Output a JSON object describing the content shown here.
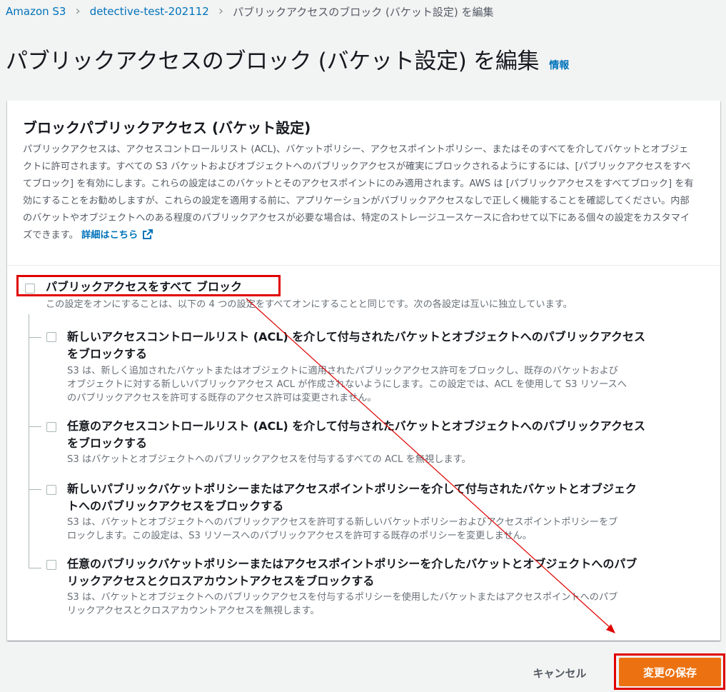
{
  "breadcrumb": {
    "items": [
      "Amazon S3",
      "detective-test-202112"
    ],
    "current": "パブリックアクセスのブロック (バケット設定) を編集"
  },
  "header": {
    "title": "パブリックアクセスのブロック (バケット設定) を編集",
    "info_label": "情報"
  },
  "panel": {
    "title": "ブロックパブリックアクセス (バケット設定)",
    "description": "パブリックアクセスは、アクセスコントロールリスト (ACL)、バケットポリシー、アクセスポイントポリシー、またはそのすべてを介してバケットとオブジェクトに許可されます。すべての S3 バケットおよびオブジェクトへのパブリックアクセスが確実にブロックされるようにするには、[パブリックアクセスをすべてブロック] を有効にします。これらの設定はこのバケットとそのアクセスポイントにのみ適用されます。AWS は [パブリックアクセスをすべてブロック] を有効にすることをお勧めしますが、これらの設定を適用する前に、アプリケーションがパブリックアクセスなしで正しく機能することを確認してください。内部のバケットやオブジェクトへのある程度のパブリックアクセスが必要な場合は、特定のストレージユースケースに合わせて以下にある個々の設定をカスタマイズできます。",
    "learn_more": "詳細はこちら"
  },
  "master_option": {
    "label": "パブリックアクセスをすべて ブロック",
    "description": "この設定をオンにすることは、以下の 4 つの設定をすべてオンにすることと同じです。次の各設定は互いに独立しています。",
    "checked": false
  },
  "options": [
    {
      "title_line1": "新しいアクセスコントロールリスト (ACL) を介して付与されたバケットとオブジェクトへのパブリックアクセス",
      "title_line2": "をブロックする",
      "desc_line1": "S3 は、新しく追加されたバケットまたはオブジェクトに適用されたパブリックアクセス許可をブロックし、既存のバケットおよび",
      "desc_line2": "オブジェクトに対する新しいパブリックアクセス ACL が作成されないようにします。この設定では、ACL を使用して S3 リソースへ",
      "desc_line3": "のパブリックアクセスを許可する既存のアクセス許可は変更されません。",
      "checked": false
    },
    {
      "title_line1": "任意のアクセスコントロールリスト (ACL) を介して付与されたバケットとオブジェクトへのパブリックアクセス",
      "title_line2": "をブロックする",
      "desc_line1": "S3 はバケットとオブジェクトへのパブリックアクセスを付与するすべての ACL を無視します。",
      "checked": false
    },
    {
      "title_line1": "新しいパブリックバケットポリシーまたはアクセスポイントポリシーを介して付与されたバケットとオブジェク",
      "title_line2": "トへのパブリックアクセスをブロックする",
      "desc_line1": "S3 は、バケットとオブジェクトへのパブリックアクセスを許可する新しいバケットポリシーおよびアクセスポイントポリシーをブ",
      "desc_line2": "ロックします。この設定は、S3 リソースへのパブリックアクセスを許可する既存のポリシーを変更しません。",
      "checked": false
    },
    {
      "title_line1": "任意のパブリックバケットポリシーまたはアクセスポイントポリシーを介したバケットとオブジェクトへのパブ",
      "title_line2": "リックアクセスとクロスアカウントアクセスをブロックする",
      "desc_line1": "S3 は、バケットとオブジェクトへのパブリックアクセスを付与するポリシーを使用したバケットまたはアクセスポイントへのパブ",
      "desc_line2": "リックアクセスとクロスアカウントアクセスを無視します。",
      "checked": false
    }
  ],
  "footer": {
    "cancel_label": "キャンセル",
    "save_label": "変更の保存"
  },
  "colors": {
    "link": "#0073bb",
    "primary_button": "#ec7211",
    "annotation": "#e00000"
  },
  "icons": {
    "breadcrumb_separator": "chevron-right-icon",
    "external_link": "external-link-icon",
    "checkbox": "checkbox-icon"
  }
}
